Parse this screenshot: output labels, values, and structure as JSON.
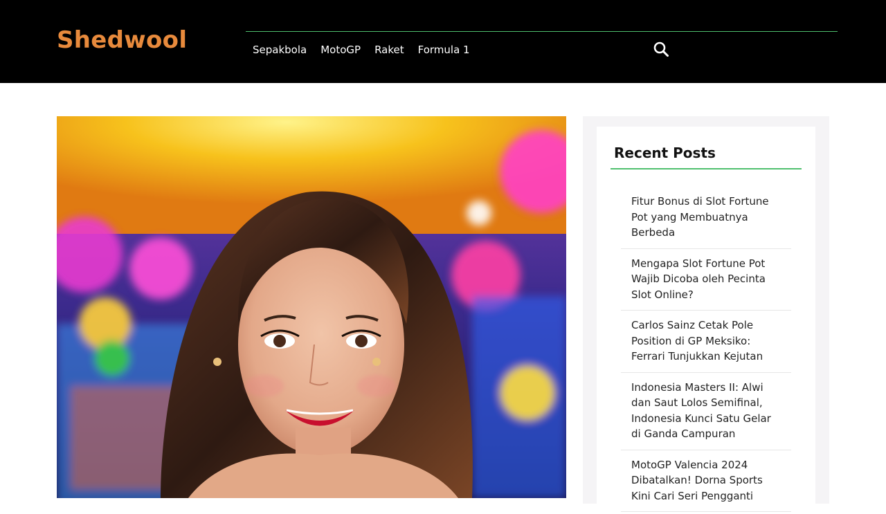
{
  "site": {
    "title": "Shedwool"
  },
  "nav": {
    "items": [
      {
        "label": "Sepakbola"
      },
      {
        "label": "MotoGP"
      },
      {
        "label": "Raket"
      },
      {
        "label": "Formula 1"
      }
    ],
    "search_icon": "search-icon"
  },
  "colors": {
    "header_bg": "#000000",
    "logo": "#e88a3c",
    "accent_green": "#4fbf6e",
    "sidebar_bg": "#f5f4f6"
  },
  "sidebar": {
    "widget_title": "Recent Posts",
    "posts": [
      {
        "title": "Fitur Bonus di Slot Fortune Pot yang Membuatnya Berbeda"
      },
      {
        "title": "Mengapa Slot Fortune Pot Wajib Dicoba oleh Pecinta Slot Online?"
      },
      {
        "title": "Carlos Sainz Cetak Pole Position di GP Meksiko: Ferrari Tunjukkan Kejutan"
      },
      {
        "title": "Indonesia Masters II: Alwi dan Saut Lolos Semifinal, Indonesia Kunci Satu Gelar di Ganda Campuran"
      },
      {
        "title": "MotoGP Valencia 2024 Dibatalkan! Dorna Sports Kini Cari Seri Pengganti"
      }
    ]
  }
}
